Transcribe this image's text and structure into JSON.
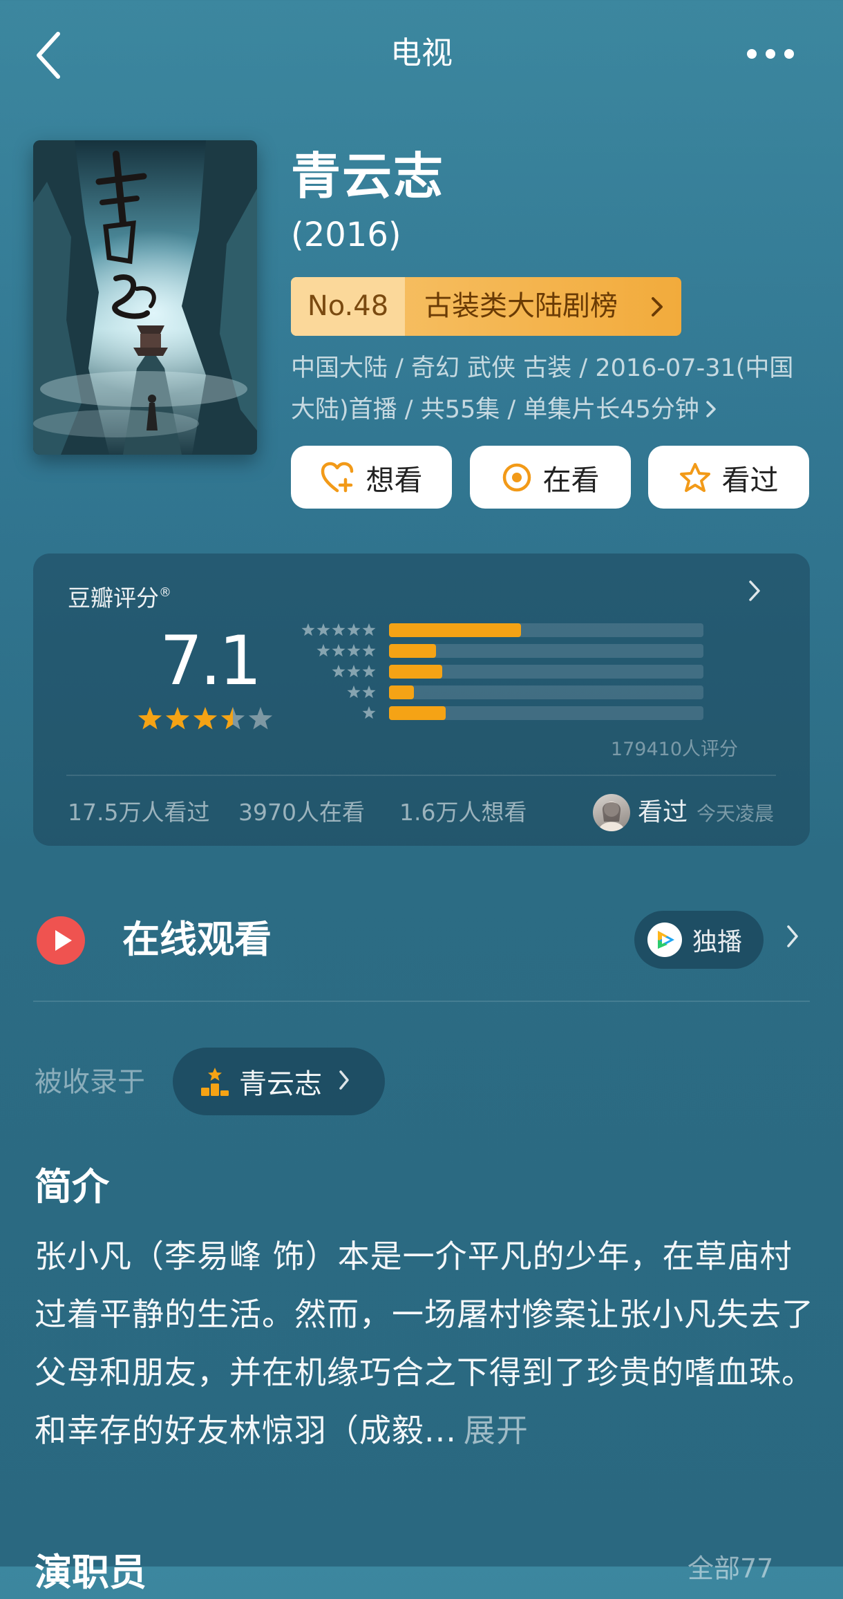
{
  "header": {
    "title": "电视"
  },
  "show": {
    "title": "青云志",
    "year": "(2016)",
    "rank_no": "No.48",
    "rank_label": "古装类大陆剧榜",
    "meta": "中国大陆 / 奇幻 武侠 古装 / 2016-07-31(中国大陆)首播 / 共55集 / 单集片长45分钟"
  },
  "actions": {
    "want": "想看",
    "watching": "在看",
    "watched": "看过"
  },
  "rating": {
    "label": "豆瓣评分",
    "trademark": "®",
    "score": "7.1",
    "stars": 3.5,
    "distribution": [
      {
        "stars": 5,
        "fraction": 0.42
      },
      {
        "stars": 4,
        "fraction": 0.15
      },
      {
        "stars": 3,
        "fraction": 0.17
      },
      {
        "stars": 2,
        "fraction": 0.08
      },
      {
        "stars": 1,
        "fraction": 0.18
      }
    ],
    "count": "179410人评分",
    "stats": {
      "watched": "17.5万人看过",
      "watching": "3970人在看",
      "wish": "1.6万人想看"
    },
    "friend": {
      "status": "看过",
      "time": "今天凌晨"
    },
    "colors": {
      "star": "#f5a315",
      "bar": "#f5a315"
    }
  },
  "online": {
    "title": "在线观看",
    "exclusive_label": "独播"
  },
  "collection": {
    "label": "被收录于",
    "name": "青云志"
  },
  "synopsis": {
    "title": "简介",
    "text": "张小凡（李易峰 饰）本是一介平凡的少年，在草庙村过着平静的生活。然而，一场屠村惨案让张小凡失去了父母和朋友，并在机缘巧合之下得到了珍贵的嗜血珠。和幸存的好友林惊羽（成毅...",
    "expand": "展开"
  },
  "cast": {
    "title": "演职员",
    "all": "全部77"
  }
}
